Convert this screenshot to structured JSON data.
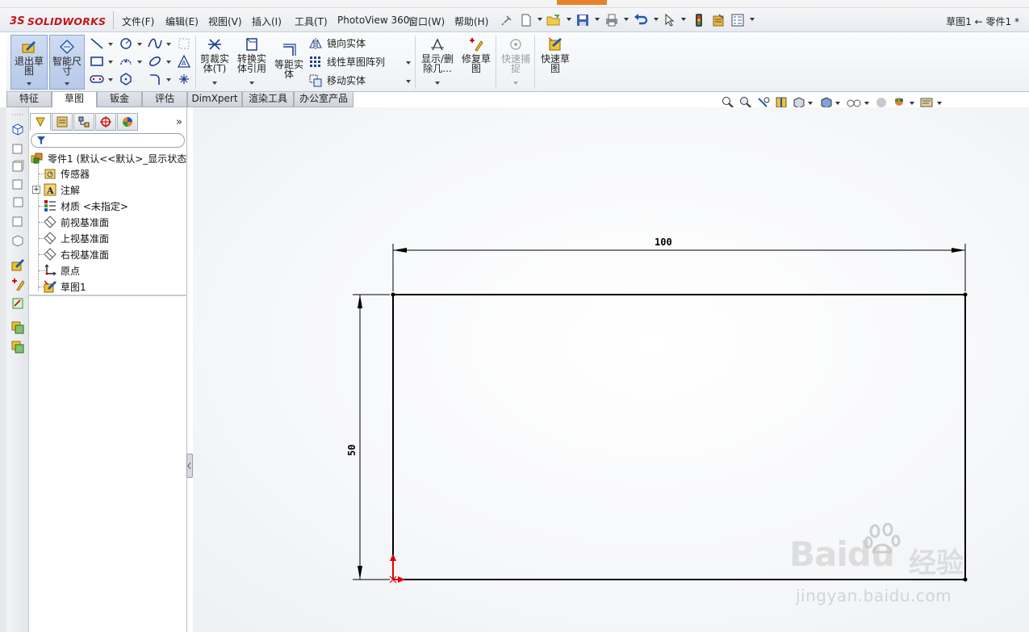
{
  "app": {
    "brand": "SOLIDWORKS",
    "brand_prefix": "3S",
    "brand_color": "#c4161c"
  },
  "menu": [
    "文件(F)",
    "编辑(E)",
    "视图(V)",
    "插入(I)",
    "工具(T)",
    "PhotoView 360",
    "窗口(W)",
    "帮助(H)"
  ],
  "quick_access": [
    "pin-icon",
    "new-document-icon",
    "open-folder-icon",
    "save-icon",
    "print-icon",
    "undo-icon",
    "select-arrow-icon",
    "traffic-light-icon",
    "file-properties-icon",
    "options-icon"
  ],
  "doc_title": "草图1 ← 零件1 *",
  "ribbon": {
    "exit_sketch": "退出草图",
    "smart_dimension": "智能尺寸",
    "trim": "剪裁实体(T)",
    "convert": "转换实体引用",
    "offset": "等距实体",
    "mirror": "镜向实体",
    "linear_pattern": "线性草图阵列",
    "move": "移动实体",
    "display_delete": "显示/删除几...",
    "repair": "修复草图",
    "quick_snaps": "快速捕捉",
    "rapid_sketch": "快速草图"
  },
  "tabs": [
    "特征",
    "草图",
    "钣金",
    "评估",
    "DimXpert",
    "渲染工具",
    "办公室产品"
  ],
  "active_tab": "草图",
  "feature_tree": {
    "root": "零件1 (默认<<默认>_显示状态",
    "items": [
      {
        "label": "传感器",
        "icon": "sensor-icon"
      },
      {
        "label": "注解",
        "icon": "annotation-icon"
      },
      {
        "label": "材质 <未指定>",
        "icon": "material-icon"
      },
      {
        "label": "前视基准面",
        "icon": "plane-icon"
      },
      {
        "label": "上视基准面",
        "icon": "plane-icon"
      },
      {
        "label": "右视基准面",
        "icon": "plane-icon"
      },
      {
        "label": "原点",
        "icon": "origin-icon"
      },
      {
        "label": "草图1",
        "icon": "sketch-icon"
      }
    ]
  },
  "sketch": {
    "dim_horizontal": "100",
    "dim_vertical": "50",
    "line_color": "#000000",
    "origin_color": "#e00000"
  },
  "watermark": {
    "logo": "Baidu",
    "cn": "经验",
    "url": "jingyan.baidu.com"
  }
}
